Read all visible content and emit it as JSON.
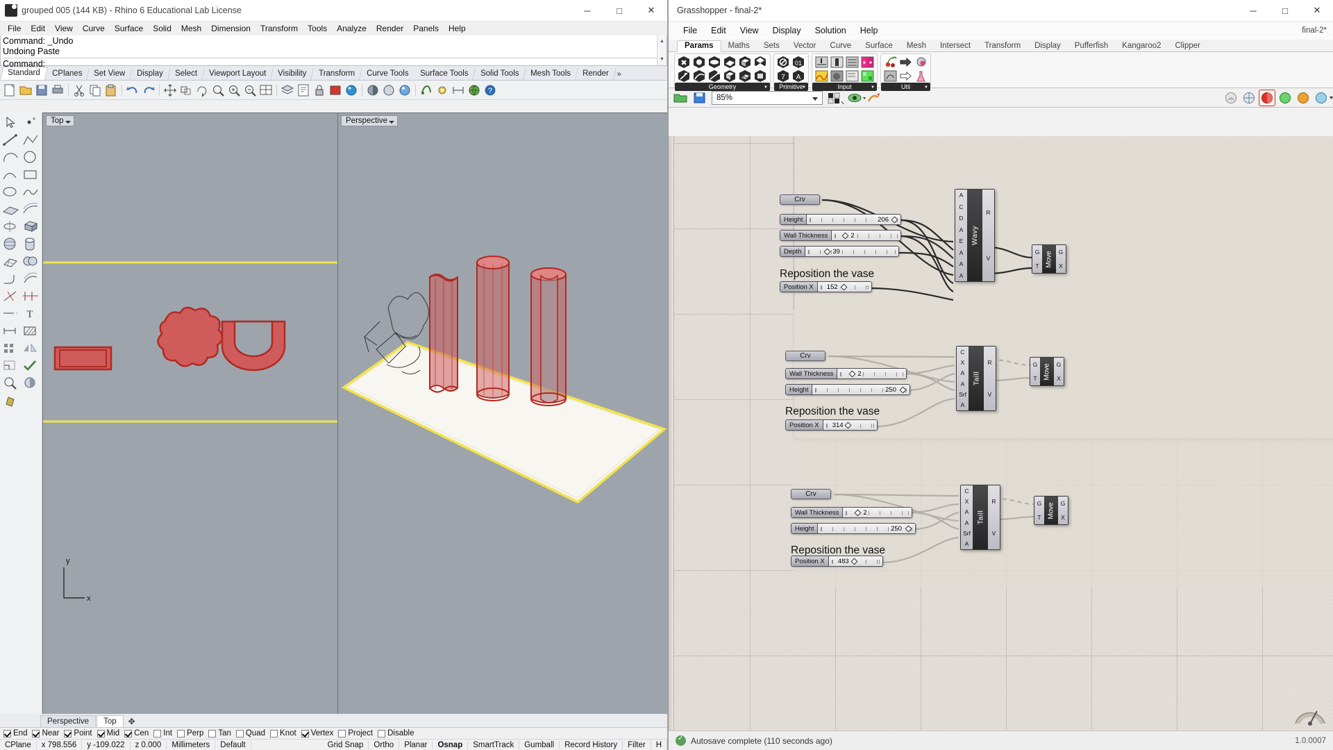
{
  "rhino": {
    "title": "grouped 005 (144 KB) - Rhino 6 Educational Lab License",
    "window_buttons": [
      "─",
      "□",
      "✕"
    ],
    "menu": [
      "File",
      "Edit",
      "View",
      "Curve",
      "Surface",
      "Solid",
      "Mesh",
      "Dimension",
      "Transform",
      "Tools",
      "Analyze",
      "Render",
      "Panels",
      "Help"
    ],
    "command_history": [
      "Command: _Undo",
      "Undoing Paste"
    ],
    "command_prompt": "Command:",
    "toolbar_tabs": [
      "Standard",
      "CPlanes",
      "Set View",
      "Display",
      "Select",
      "Viewport Layout",
      "Visibility",
      "Transform",
      "Curve Tools",
      "Surface Tools",
      "Solid Tools",
      "Mesh Tools",
      "Render"
    ],
    "toolbar_tabs_more": "»",
    "active_toolbar_tab": "Standard",
    "viewports": [
      {
        "name": "Top"
      },
      {
        "name": "Perspective"
      }
    ],
    "viewport_tabs": [
      "Perspective",
      "Top"
    ],
    "active_viewport_tab": "Top",
    "viewport_tab_add": "✥",
    "osnap": [
      {
        "label": "End",
        "on": true
      },
      {
        "label": "Near",
        "on": true
      },
      {
        "label": "Point",
        "on": true
      },
      {
        "label": "Mid",
        "on": true
      },
      {
        "label": "Cen",
        "on": true
      },
      {
        "label": "Int",
        "on": false
      },
      {
        "label": "Perp",
        "on": false
      },
      {
        "label": "Tan",
        "on": false
      },
      {
        "label": "Quad",
        "on": false
      },
      {
        "label": "Knot",
        "on": false
      },
      {
        "label": "Vertex",
        "on": true
      },
      {
        "label": "Project",
        "on": false
      },
      {
        "label": "Disable",
        "on": false
      }
    ],
    "status": {
      "cplane": "CPlane",
      "x": "x 798.556",
      "y": "y -109.022",
      "z": "z 0.000",
      "units": "Millimeters",
      "layer": "Default",
      "toggles": [
        "Grid Snap",
        "Ortho",
        "Planar",
        "Osnap",
        "SmartTrack",
        "Gumball",
        "Record History",
        "Filter"
      ],
      "active_toggles": [
        "Osnap"
      ],
      "filter_more": "Н"
    },
    "axis_labels": {
      "x": "x",
      "y": "y"
    }
  },
  "grasshopper": {
    "title": "Grasshopper - final-2*",
    "window_buttons": [
      "─",
      "□",
      "✕"
    ],
    "menu": [
      "File",
      "Edit",
      "View",
      "Display",
      "Solution",
      "Help"
    ],
    "document_name": "final-2*",
    "ribbon_tabs": [
      "Params",
      "Maths",
      "Sets",
      "Vector",
      "Curve",
      "Surface",
      "Mesh",
      "Intersect",
      "Transform",
      "Display",
      "Pufferfish",
      "Kangaroo2",
      "Clipper"
    ],
    "active_ribbon_tab": "Params",
    "ribbon_groups": [
      {
        "label": "Geometry",
        "columns": 6
      },
      {
        "label": "Primitive",
        "columns": 2
      },
      {
        "label": "Input",
        "columns": 3
      },
      {
        "label": "Util",
        "columns": 3
      }
    ],
    "canvas_toolbar": {
      "zoom_value": "85%",
      "icons": [
        "open-file-icon",
        "save-file-icon",
        "sketch-icon",
        "preview-eye-icon",
        "bake-icon"
      ],
      "right_icons": [
        "preview-off-icon",
        "wireframe-preview-icon",
        "shaded-preview-icon",
        "draw-icons-icon",
        "draw-fancy-wires-icon",
        "transparency-icon"
      ]
    },
    "status": {
      "autosave_message": "Autosave complete (110 seconds ago)",
      "version": "1.0.0007"
    },
    "groups": [
      {
        "id": "grp-1",
        "label": "Reposition the vase",
        "curve_param": "Crv",
        "sliders": [
          {
            "name": "Height",
            "value": "206",
            "knob_pos": 0.88
          },
          {
            "name": "Wall Thickness",
            "value": "2",
            "knob_pos": 0.2
          },
          {
            "name": "Depth",
            "value": "39",
            "knob_pos": 0.26
          }
        ],
        "position_slider": {
          "name": "Position X",
          "value": "152",
          "knob_pos": 0.6
        },
        "component": {
          "name": "Wavy",
          "inputs": [
            "A",
            "C",
            "D",
            "A",
            "E",
            "A",
            "A",
            "A"
          ],
          "outputs": [
            "R",
            "V"
          ]
        },
        "move": {
          "name": "Move",
          "inputs": [
            "G",
            "T"
          ],
          "outputs": [
            "G",
            "X"
          ]
        }
      },
      {
        "id": "grp-2",
        "label": "Reposition the vase",
        "curve_param": "Crv",
        "sliders": [
          {
            "name": "Wall Thickness",
            "value": "2",
            "knob_pos": 0.22
          },
          {
            "name": "Height",
            "value": "250",
            "knob_pos": 0.86
          }
        ],
        "position_slider": {
          "name": "Position X",
          "value": "314",
          "knob_pos": 0.56
        },
        "component": {
          "name": "Taill",
          "inputs": [
            "C",
            "X",
            "A",
            "A",
            "Srf",
            "A"
          ],
          "outputs": [
            "R",
            "V"
          ]
        },
        "move": {
          "name": "Move",
          "inputs": [
            "G",
            "T"
          ],
          "outputs": [
            "G",
            "X"
          ]
        }
      },
      {
        "id": "grp-3",
        "label": "Reposition the vase",
        "curve_param": "Crv",
        "sliders": [
          {
            "name": "Wall Thickness",
            "value": "2",
            "knob_pos": 0.22
          },
          {
            "name": "Height",
            "value": "250",
            "knob_pos": 0.86
          }
        ],
        "position_slider": {
          "name": "Position X",
          "value": "483",
          "knob_pos": 0.58
        },
        "component": {
          "name": "Taill",
          "inputs": [
            "C",
            "X",
            "A",
            "A",
            "Srf",
            "A"
          ],
          "outputs": [
            "R",
            "V"
          ]
        },
        "move": {
          "name": "Move",
          "inputs": [
            "G",
            "T"
          ],
          "outputs": [
            "G",
            "X"
          ]
        }
      }
    ]
  },
  "colors": {
    "rhino_object_red": "#c0392b",
    "rhino_object_fill": "#cf5b5b",
    "viewport_bg": "#9ea4ab",
    "construction_plane_yellow": "#f2e34a",
    "gh_canvas_bg": "#e3dfd8",
    "gh_group_bg": "#e0dcd4",
    "gh_accent_red": "#d9352b",
    "autosave_green": "#5b9f5b"
  }
}
